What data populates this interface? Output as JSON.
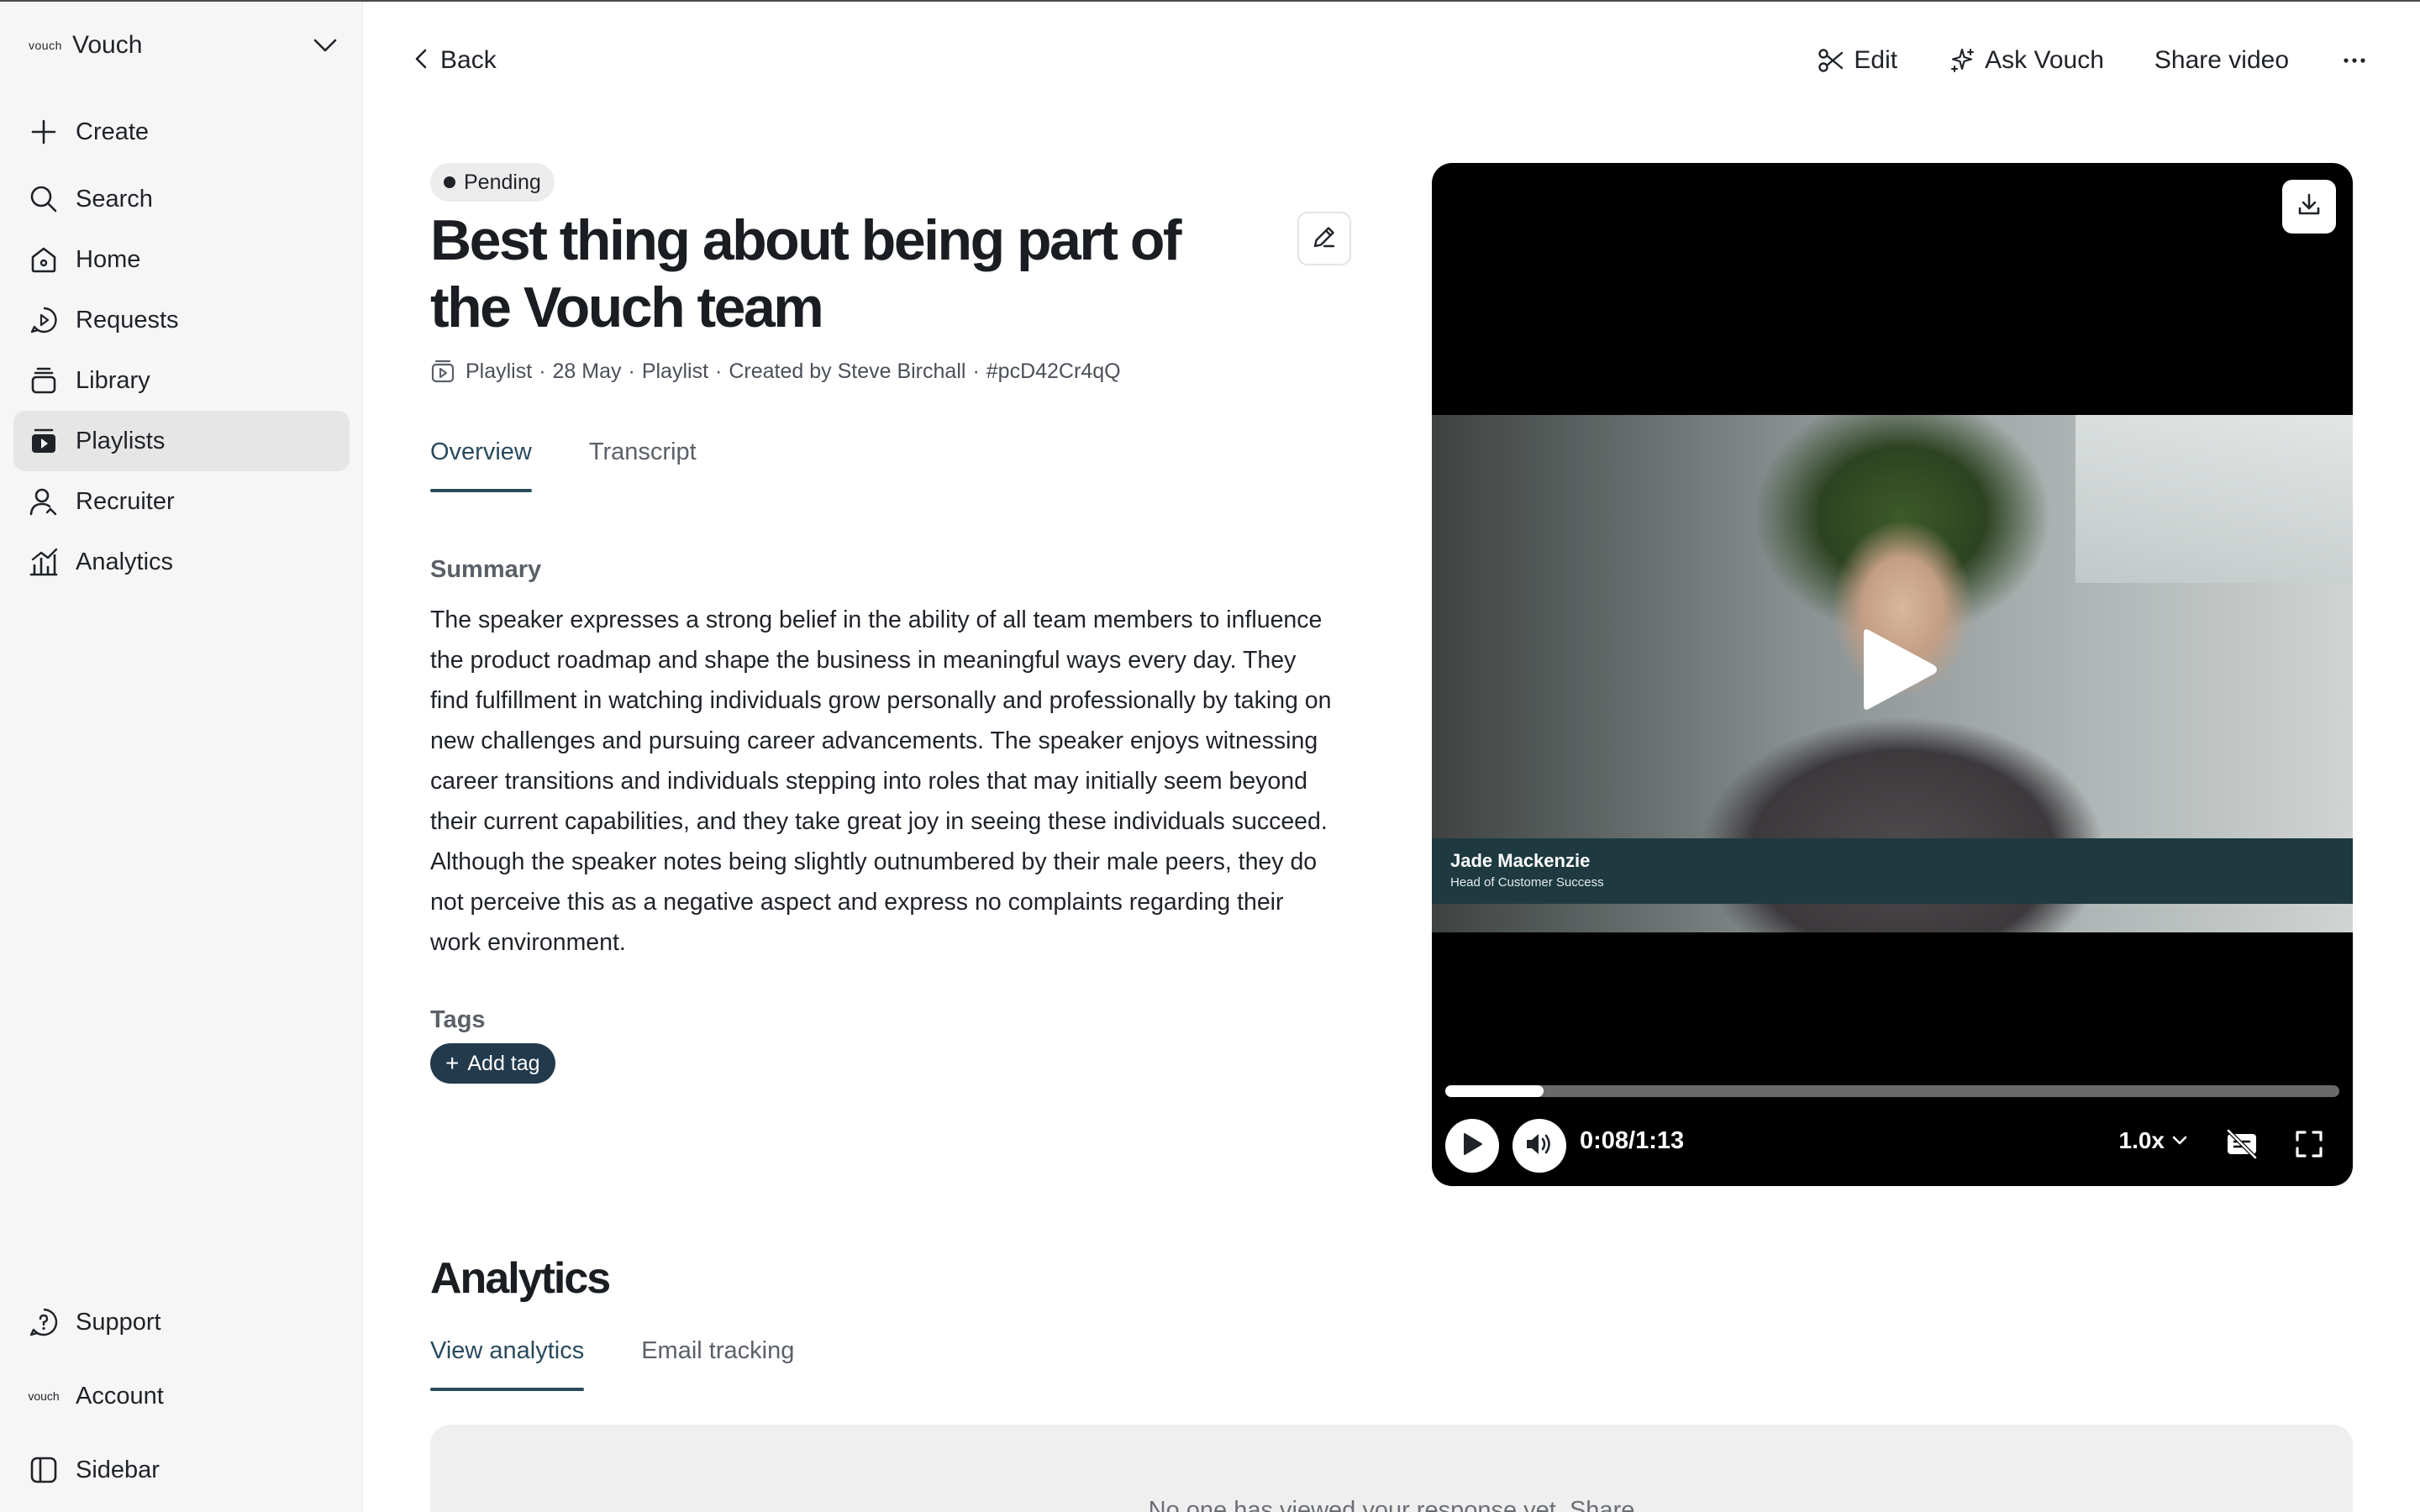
{
  "sidebar": {
    "workspace": {
      "logo_text": "vouch",
      "name": "Vouch"
    },
    "nav": [
      {
        "label": "Create",
        "icon": "plus-icon"
      },
      {
        "label": "Search",
        "icon": "search-icon"
      },
      {
        "label": "Home",
        "icon": "home-icon"
      },
      {
        "label": "Requests",
        "icon": "requests-icon"
      },
      {
        "label": "Library",
        "icon": "library-icon"
      },
      {
        "label": "Playlists",
        "icon": "playlists-icon",
        "active": true
      },
      {
        "label": "Recruiter",
        "icon": "recruiter-icon"
      },
      {
        "label": "Analytics",
        "icon": "analytics-icon"
      }
    ],
    "bottom": [
      {
        "label": "Support",
        "icon": "help-icon"
      },
      {
        "label": "Account",
        "icon": "vouch-logo-icon",
        "logo_text": "vouch"
      },
      {
        "label": "Sidebar",
        "icon": "sidebar-toggle-icon"
      }
    ]
  },
  "topbar": {
    "back_label": "Back",
    "actions": {
      "edit": "Edit",
      "ask_vouch": "Ask Vouch",
      "share_video": "Share video"
    }
  },
  "content": {
    "status": "Pending",
    "title": "Best thing about being part of the Vouch team",
    "meta": {
      "type": "Playlist",
      "date": "28 May",
      "kind": "Playlist",
      "created_by": "Created by Steve Birchall",
      "id": "#pcD42Cr4qQ",
      "separator": "·"
    },
    "tabs": [
      "Overview",
      "Transcript"
    ],
    "active_tab": "Overview",
    "summary_heading": "Summary",
    "summary": "The speaker expresses a strong belief in the ability of all team members to influence the product roadmap and shape the business in meaningful ways every day. They find fulfillment in watching individuals grow personally and professionally by taking on new challenges and pursuing career advancements. The speaker enjoys witnessing career transitions and individuals stepping into roles that may initially seem beyond their current capabilities, and they take great joy in seeing these individuals succeed. Although the speaker notes being slightly outnumbered by their male peers, they do not perceive this as a negative aspect and express no complaints regarding their work environment.",
    "tags_heading": "Tags",
    "add_tag_label": "Add tag"
  },
  "player": {
    "speaker_name": "Jade Mackenzie",
    "speaker_role": "Head of Customer Success",
    "time": "0:08/1:13",
    "progress_fraction": 0.11,
    "speed": "1.0x"
  },
  "analytics": {
    "title": "Analytics",
    "tabs": [
      "View analytics",
      "Email tracking"
    ],
    "active_tab": "View analytics",
    "empty_message": "No one has viewed your response yet. Share"
  },
  "colors": {
    "accent": "#2a4a5e",
    "tag_button": "#233a4c",
    "sidebar_bg": "#f6f6f6",
    "active_nav_bg": "#e6e6e6"
  }
}
